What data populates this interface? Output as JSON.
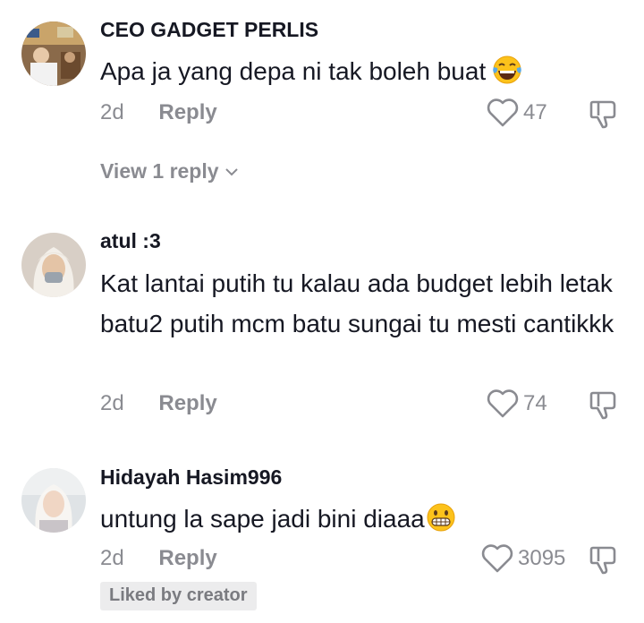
{
  "comments": [
    {
      "username": "CEO GADGET PERLIS",
      "text": "Apa ja yang depa ni tak boleh buat",
      "emoji": "laughing-tears-emoji",
      "time": "2d",
      "reply_label": "Reply",
      "likes": "47",
      "view_replies": "View 1 reply"
    },
    {
      "username": "atul :3",
      "text": "Kat lantai putih tu kalau ada budget lebih letak batu2 putih mcm batu sungai tu mesti cantikkk",
      "time": "2d",
      "reply_label": "Reply",
      "likes": "74"
    },
    {
      "username": "Hidayah Hasim996",
      "text": "untung la sape jadi bini diaaa",
      "emoji": "grinning-emoji",
      "time": "2d",
      "reply_label": "Reply",
      "likes": "3095",
      "badge": "Liked by creator"
    }
  ],
  "colors": {
    "text": "#161823",
    "muted": "#8a8b91",
    "badge_bg": "#ececed"
  }
}
